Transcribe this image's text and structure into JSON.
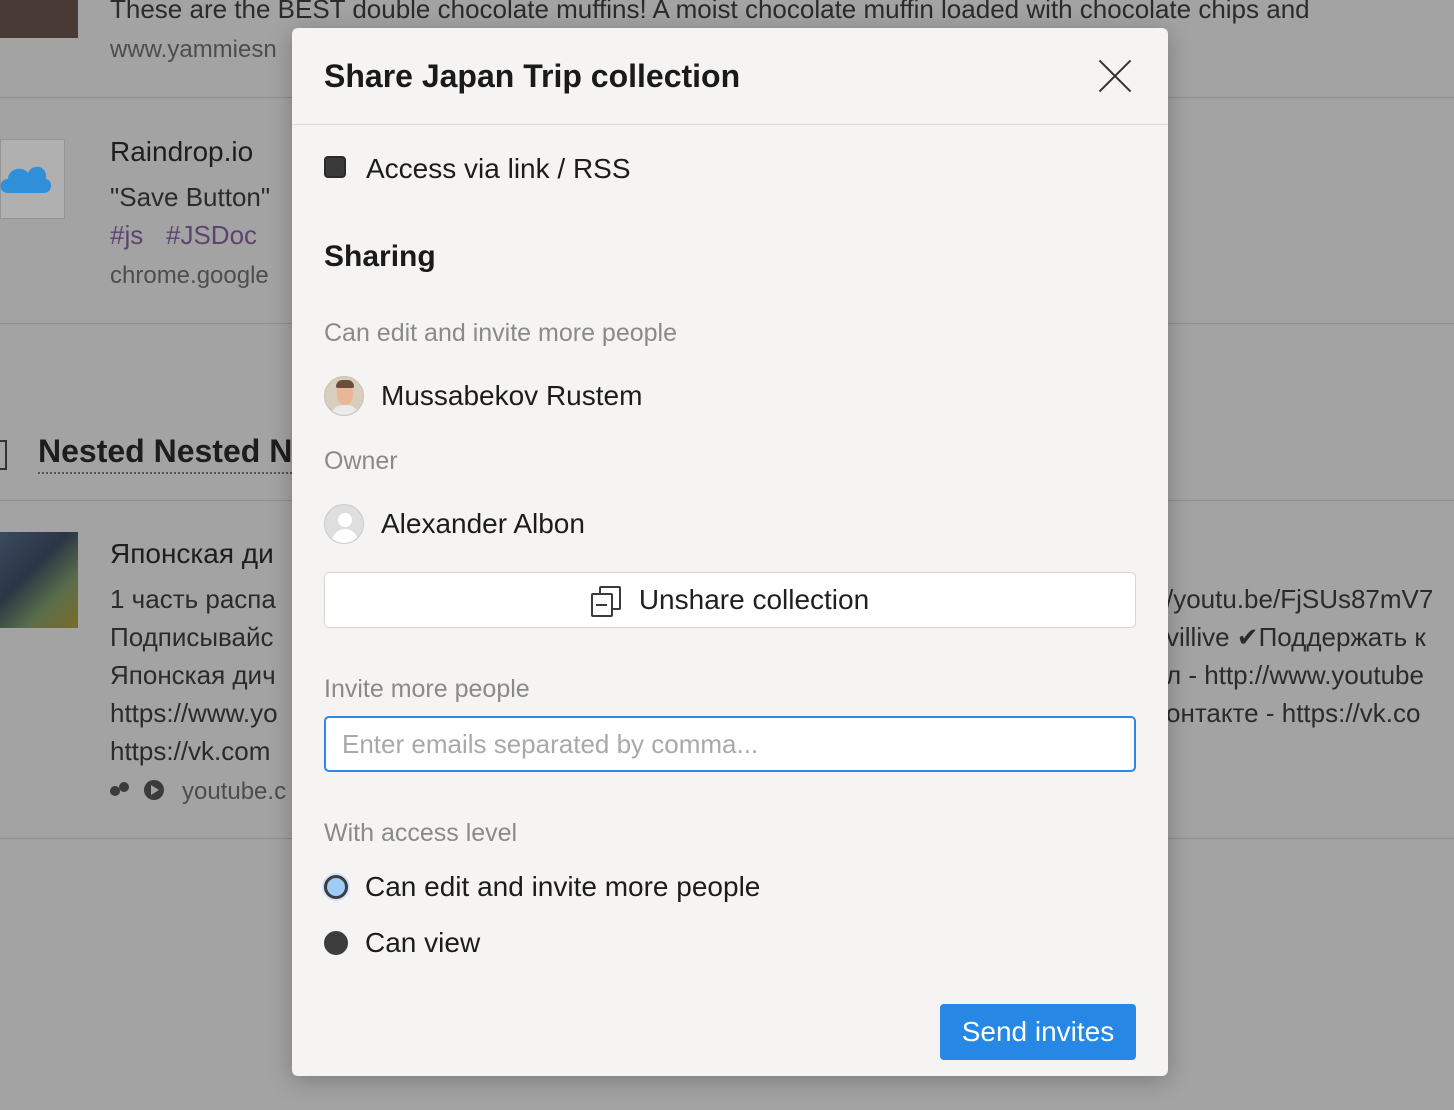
{
  "background": {
    "item1": {
      "description": "These are the BEST double chocolate muffins! A moist chocolate muffin loaded with chocolate chips and",
      "host": "www.yammiesn"
    },
    "item2": {
      "title": "Raindrop.io",
      "description": "\"Save Button\"",
      "tags": [
        "#js",
        "#JSDoc"
      ],
      "host": "chrome.google"
    },
    "section_title": "Nested Nested N",
    "item3": {
      "title": "Японская ди",
      "lines_left": [
        "1 часть распа",
        "Подписывайс",
        "Японская дич",
        "https://www.yo",
        "https://vk.com"
      ],
      "lines_right": [
        "/youtu.be/FjSUs87mV7",
        "villive ✔Поддержать к",
        "л - http://www.youtube",
        "онтакте - https://vk.co"
      ],
      "host": "youtube.c"
    }
  },
  "modal": {
    "title": "Share Japan Trip collection",
    "access_link_label": "Access via link / RSS",
    "sharing_heading": "Sharing",
    "editors_heading": "Can edit and invite more people",
    "editor_name": "Mussabekov Rustem",
    "owner_heading": "Owner",
    "owner_name": "Alexander Albon",
    "unshare_label": "Unshare collection",
    "invite_heading": "Invite more people",
    "invite_placeholder": "Enter emails separated by comma...",
    "access_level_heading": "With access level",
    "access_options": [
      "Can edit and invite more people",
      "Can view"
    ],
    "selected_access": "Can edit and invite more people",
    "send_label": "Send invites"
  },
  "colors": {
    "accent": "#2687e5",
    "overlay": "#a3a3a3",
    "modal_bg": "#f5f4f2"
  }
}
